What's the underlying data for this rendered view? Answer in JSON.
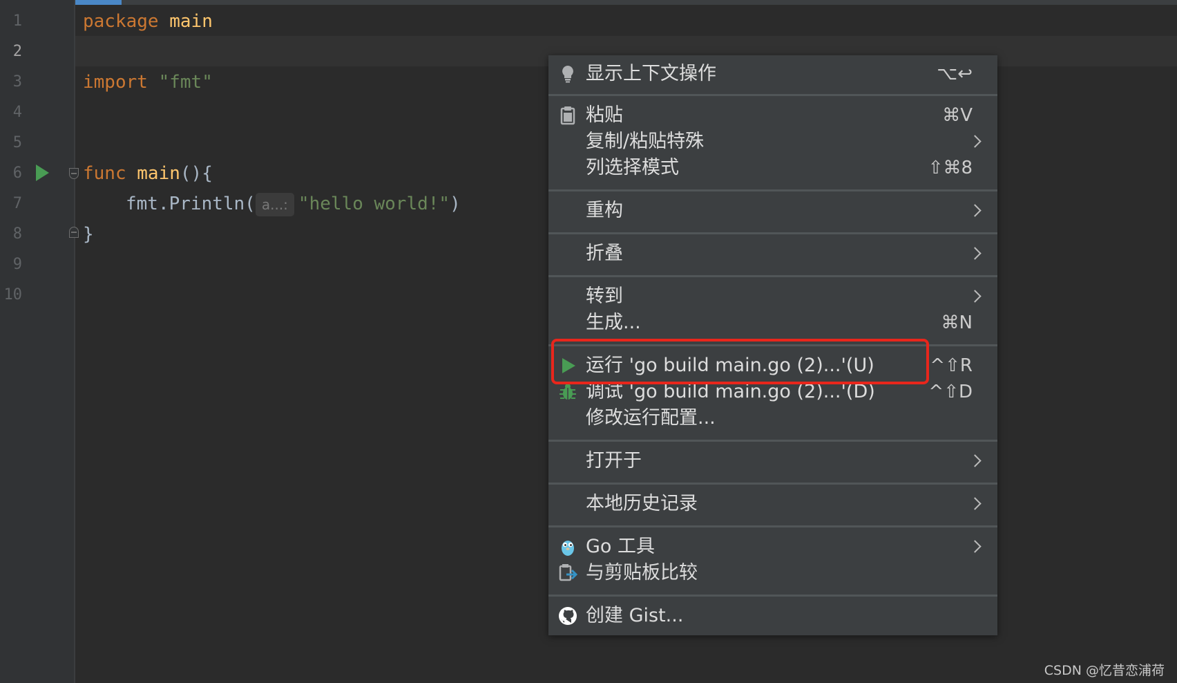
{
  "editor": {
    "line_numbers": [
      "1",
      "2",
      "3",
      "4",
      "5",
      "6",
      "7",
      "8",
      "9",
      "10"
    ],
    "current_line": "2",
    "code": {
      "line1": {
        "keyword": "package",
        "name": "main"
      },
      "line3": {
        "keyword": "import",
        "string": "\"fmt\""
      },
      "line6": {
        "keyword": "func",
        "name": "main",
        "rest": "(){"
      },
      "line7": {
        "call": "fmt.Println(",
        "hint": "a...:",
        "string": "\"hello world!\"",
        "close": ")"
      },
      "line8": {
        "brace": "}"
      }
    }
  },
  "context_menu": {
    "show_context_actions": {
      "label": "显示上下文操作",
      "shortcut": "⌥↩",
      "icon": "lightbulb-icon"
    },
    "paste": {
      "label": "粘贴",
      "shortcut": "⌘V",
      "icon": "clipboard-icon"
    },
    "copy_paste_special": {
      "label": "复制/粘贴特殊"
    },
    "column_selection_mode": {
      "label": "列选择模式",
      "shortcut": "⇧⌘8"
    },
    "refactor": {
      "label": "重构"
    },
    "folding": {
      "label": "折叠"
    },
    "go_to": {
      "label": "转到"
    },
    "generate": {
      "label": "生成...",
      "shortcut": "⌘N"
    },
    "run": {
      "label": "运行 'go build main.go (2)...'(U)",
      "shortcut": "^⇧R",
      "icon": "run-icon"
    },
    "debug": {
      "label": "调试 'go build main.go (2)...'(D)",
      "shortcut": "^⇧D",
      "icon": "debug-icon"
    },
    "modify_run_config": {
      "label": "修改运行配置..."
    },
    "open_in": {
      "label": "打开于"
    },
    "local_history": {
      "label": "本地历史记录"
    },
    "go_tools": {
      "label": "Go 工具",
      "icon": "gopher-icon"
    },
    "compare_with_clipboard": {
      "label": "与剪贴板比较",
      "icon": "compare-clipboard-icon"
    },
    "create_gist": {
      "label": "创建 Gist...",
      "icon": "github-icon"
    }
  },
  "watermark": "CSDN @忆昔恋浦荷",
  "colors": {
    "editor_bg": "#2b2b2b",
    "menu_bg": "#3c3f41",
    "highlight": "#e8261c",
    "run_green": "#499c54"
  }
}
